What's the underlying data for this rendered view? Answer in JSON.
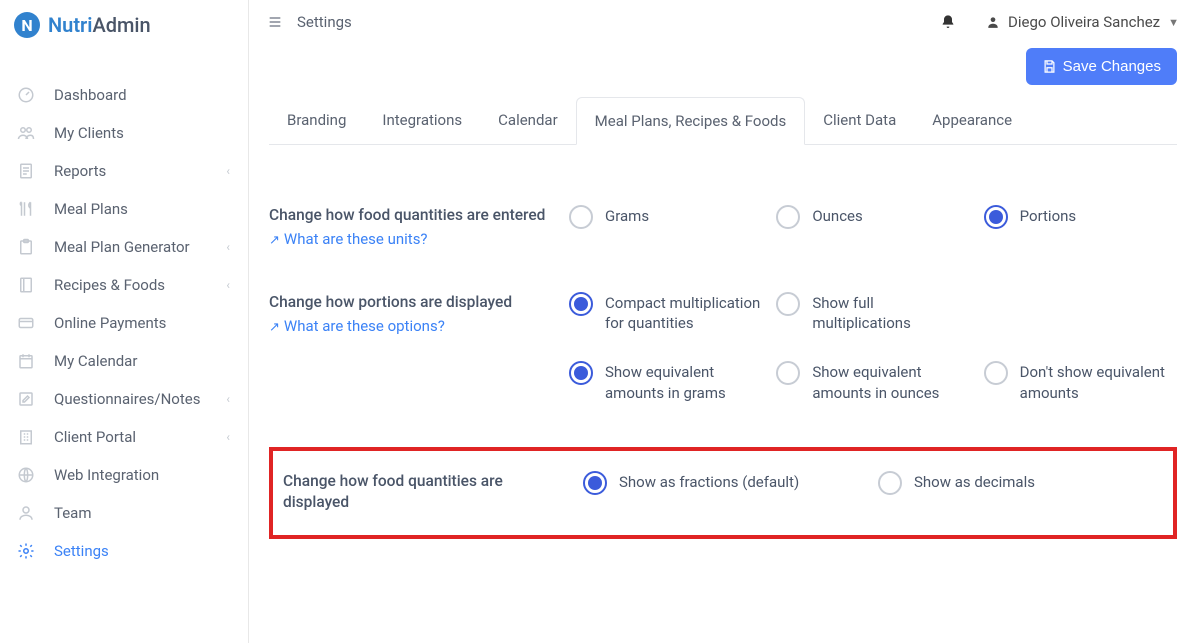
{
  "brand": {
    "a": "Nutri",
    "b": "Admin",
    "mark": "N"
  },
  "nav": {
    "items": [
      {
        "label": "Dashboard",
        "chevron": false
      },
      {
        "label": "My Clients",
        "chevron": false
      },
      {
        "label": "Reports",
        "chevron": true
      },
      {
        "label": "Meal Plans",
        "chevron": false
      },
      {
        "label": "Meal Plan Generator",
        "chevron": true
      },
      {
        "label": "Recipes & Foods",
        "chevron": true
      },
      {
        "label": "Online Payments",
        "chevron": false
      },
      {
        "label": "My Calendar",
        "chevron": false
      },
      {
        "label": "Questionnaires/Notes",
        "chevron": true
      },
      {
        "label": "Client Portal",
        "chevron": true
      },
      {
        "label": "Web Integration",
        "chevron": false
      },
      {
        "label": "Team",
        "chevron": false
      },
      {
        "label": "Settings",
        "chevron": false
      }
    ]
  },
  "topbar": {
    "crumb": "Settings",
    "user": "Diego Oliveira Sanchez"
  },
  "actions": {
    "save": "Save Changes"
  },
  "tabs": [
    "Branding",
    "Integrations",
    "Calendar",
    "Meal Plans, Recipes & Foods",
    "Client Data",
    "Appearance"
  ],
  "settings": {
    "units": {
      "title": "Change how food quantities are entered",
      "help": "What are these units?",
      "options": [
        "Grams",
        "Ounces",
        "Portions"
      ],
      "selected": 2
    },
    "portions": {
      "title": "Change how portions are displayed",
      "help": "What are these options?",
      "row1": [
        "Compact multiplication for quantities",
        "Show full multiplications",
        ""
      ],
      "row2": [
        "Show equivalent amounts in grams",
        "Show equivalent amounts in ounces",
        "Don't show equivalent amounts"
      ],
      "selected1": 0,
      "selected2": 0
    },
    "quantities": {
      "title": "Change how food quantities are displayed",
      "options": [
        "Show as fractions (default)",
        "Show as decimals"
      ],
      "selected": 0
    }
  }
}
